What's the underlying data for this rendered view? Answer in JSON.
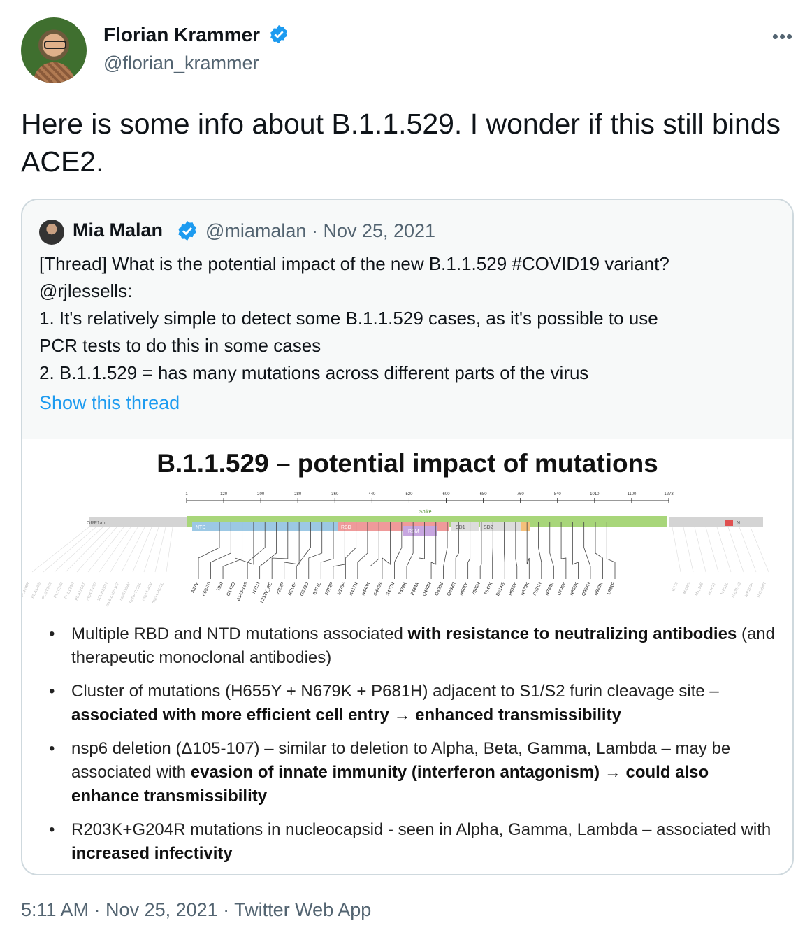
{
  "author": {
    "name": "Florian Krammer",
    "handle": "@florian_krammer",
    "verified": true,
    "more_icon": "more-horizontal-icon"
  },
  "tweet": {
    "text": "Here is some info about B.1.1.529. I wonder if this still binds ACE2."
  },
  "quoted_tweet": {
    "name": "Mia Malan",
    "handle_date": "@miamalan · Nov 25, 2021",
    "verified": true,
    "lines": [
      "[Thread] What is the potential impact of the new  B.1.1.529 #COVID19 variant?",
      "@rjlessells:",
      "1. It's relatively simple to detect some B.1.1.529 cases, as it's possible to use",
      "PCR tests to do this in some cases",
      "2. B.1.1.529 = has many mutations across different parts of the virus"
    ],
    "show_thread": "Show this thread"
  },
  "slide": {
    "title": "B.1.1.529 – potential impact of mutations",
    "ruler_ticks": [
      "1",
      "120",
      "200",
      "280",
      "360",
      "440",
      "520",
      "600",
      "680",
      "760",
      "840",
      "1010",
      "1100",
      "1273"
    ],
    "region_labels": {
      "orf": "ORF1ab",
      "spike": "Spike",
      "ntd": "NTD",
      "rbd": "RBD",
      "rbm": "RBM",
      "sd1": "SD1",
      "sd2": "SD2",
      "n": "N"
    },
    "spike_mutations": [
      "A67V",
      "Δ69-70",
      "T95I",
      "G142D",
      "Δ143-145",
      "N211I",
      "L212V_RE",
      "V213P",
      "R214E",
      "G339D",
      "S371L",
      "S373P",
      "S375F",
      "K417N",
      "N440K",
      "G446S",
      "S477N",
      "T478K",
      "E484A",
      "Q493R",
      "G496S",
      "Q498R",
      "N501Y",
      "Y505H",
      "T547K",
      "D614G",
      "H655Y",
      "N679K",
      "P681H",
      "N764K",
      "D796Y",
      "N856K",
      "Q954H",
      "N969K",
      "L981F"
    ],
    "left_mutations": [
      "PL:K38R",
      "PL:Δ1265",
      "PL:V1069I",
      "PL:I1266I",
      "PL:L1266I",
      "PL:A1892T",
      "nsp4:T492I",
      "3CL:P132H",
      "nsp6:Δ105-107",
      "nsp6:I189V",
      "RdRP:P323L",
      "nsp14:I42V",
      "nsp14:P232L"
    ],
    "right_mutations": [
      "E:T9I",
      "M:D3G",
      "M:Q19E",
      "M:A63T",
      "N:P13L",
      "N:Δ31-33",
      "N:R203K",
      "N:G204R"
    ],
    "bullets": [
      {
        "pre": "Multiple RBD and NTD mutations associated ",
        "bold": "with resistance to neutralizing antibodies",
        "post": " (and therapeutic monoclonal antibodies)"
      },
      {
        "pre": "Cluster of mutations (H655Y + N679K + P681H) adjacent to S1/S2 furin cleavage site – ",
        "bold": "associated with more efficient cell entry → enhanced transmissibility",
        "post": ""
      },
      {
        "pre": "nsp6 deletion (Δ105-107) – similar to deletion to Alpha, Beta, Gamma, Lambda – may be associated with ",
        "bold": "evasion of innate immunity (interferon antagonism) → could also enhance transmissibility",
        "post": ""
      },
      {
        "pre": "R203K+G204R mutations in nucleocapsid - seen in Alpha, Gamma, Lambda – associated with ",
        "bold": "increased infectivity",
        "post": ""
      }
    ]
  },
  "meta": "5:11 AM · Nov 25, 2021 · Twitter Web App",
  "colors": {
    "verified": "#1d9bf0",
    "link": "#1d9bf0",
    "muted": "#536471",
    "border": "#cfd9de",
    "spike": "#a8d67a",
    "ntd": "#9cc8e4",
    "rbd": "#ef9a9a",
    "rbm": "#c7a6e0",
    "s2": "#f5c07a",
    "grey_region": "#d4d4d4"
  }
}
